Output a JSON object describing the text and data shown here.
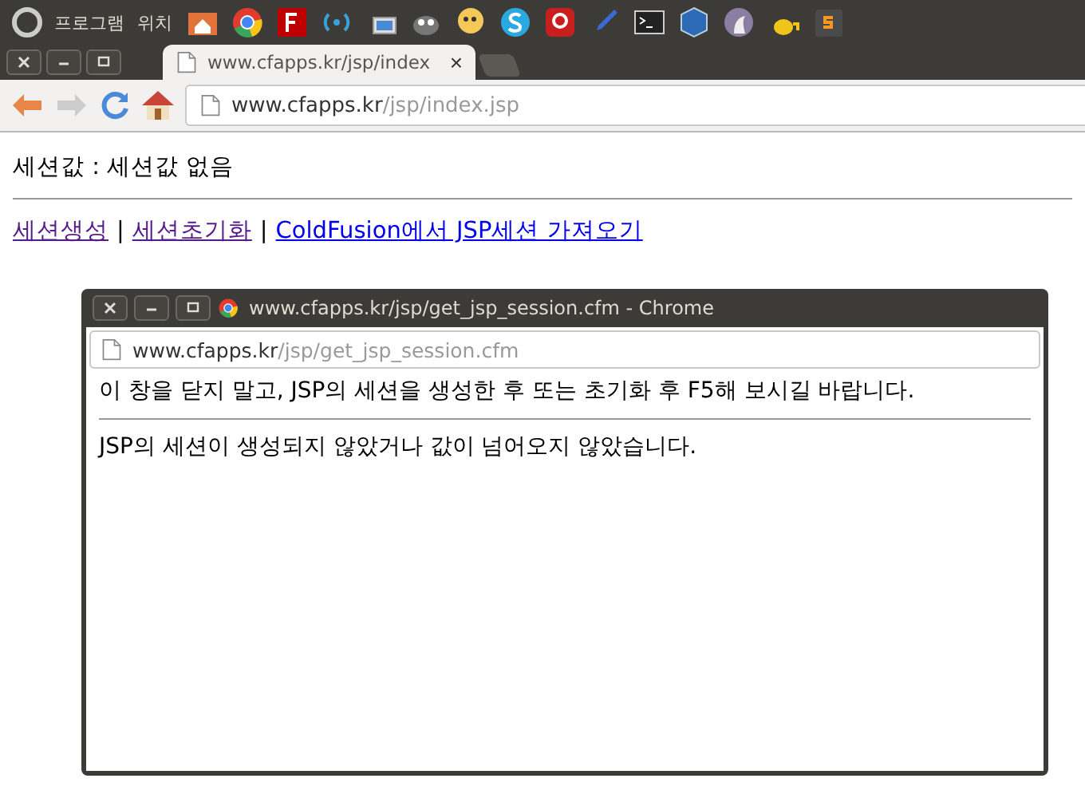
{
  "top_panel": {
    "menus": [
      "프로그램",
      "위치"
    ]
  },
  "browser": {
    "tab": {
      "title": "www.cfapps.kr/jsp/index",
      "close": "×"
    },
    "url_host": "www.cfapps.kr",
    "url_path": "/jsp/index.jsp"
  },
  "page": {
    "session_text": "세션값 : 세션값 없음",
    "links": [
      {
        "label": "세션생성",
        "visited": true
      },
      {
        "label": "세션초기화",
        "visited": true
      },
      {
        "label": "ColdFusion에서 JSP세션 가져오기",
        "visited": false
      }
    ],
    "separator": "|"
  },
  "popup": {
    "title": "www.cfapps.kr/jsp/get_jsp_session.cfm - Chrome",
    "url_host": "www.cfapps.kr",
    "url_path": "/jsp/get_jsp_session.cfm",
    "instruction": "이 창을 닫지 말고, JSP의 세션을 생성한 후 또는 초기화 후 F5해 보시길 바랍니다.",
    "message": "JSP의 세션이 생성되지 않았거나 값이 넘어오지 않았습니다."
  }
}
